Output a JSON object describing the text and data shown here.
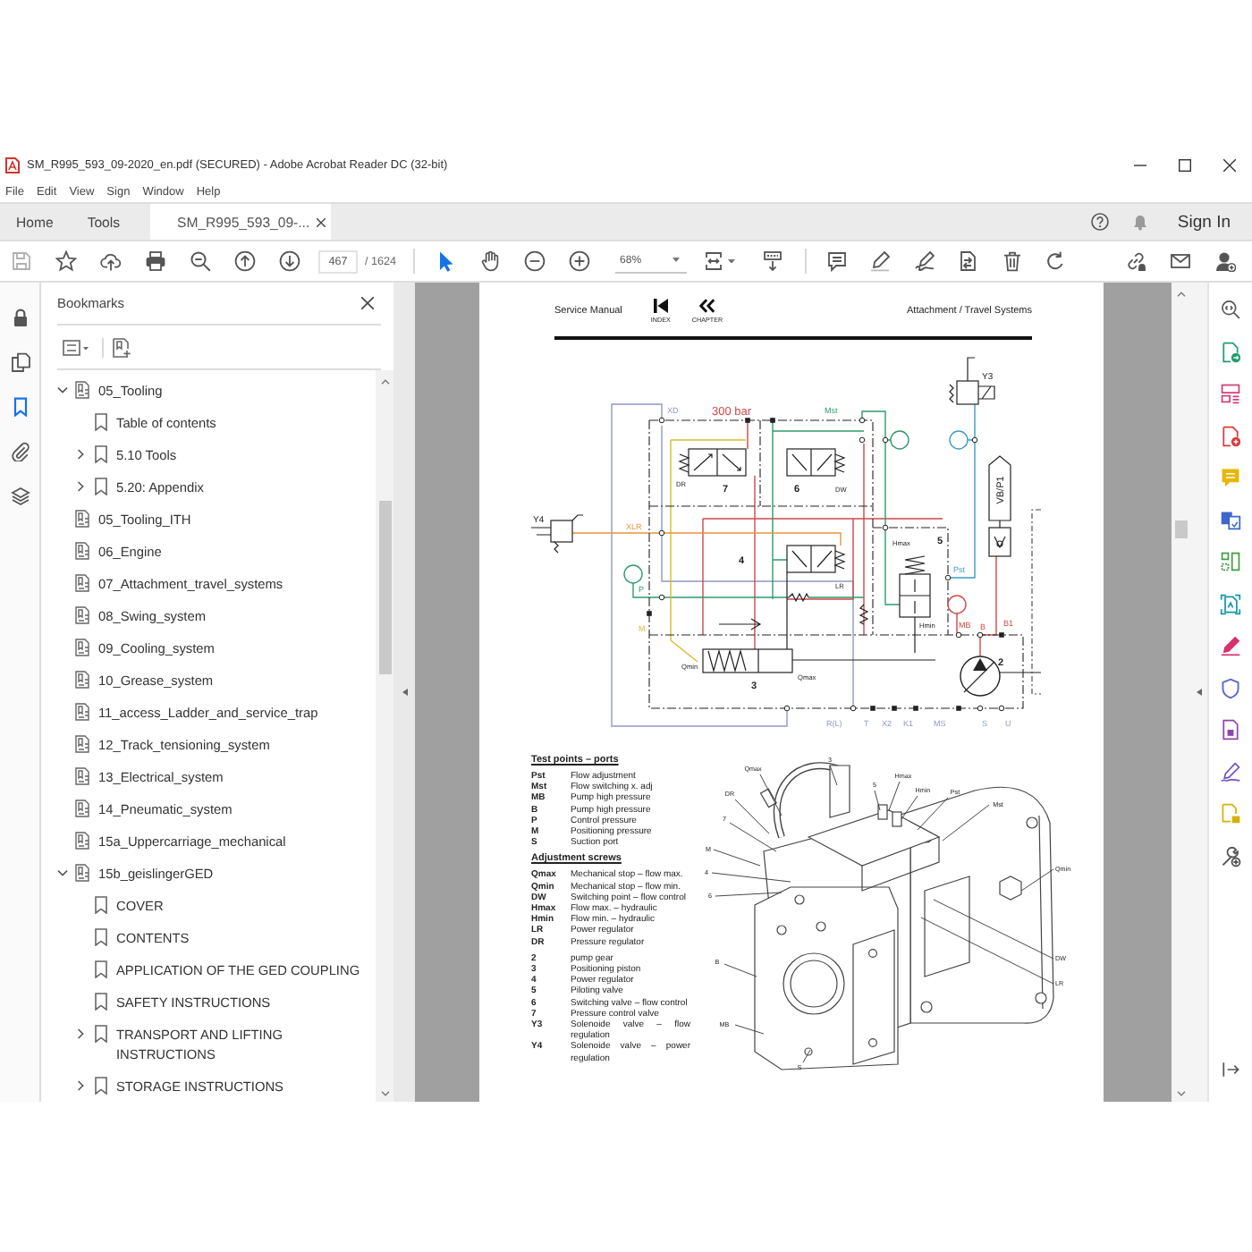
{
  "window": {
    "title": "SM_R995_593_09-2020_en.pdf (SECURED) - Adobe Acrobat Reader DC (32-bit)"
  },
  "menu": [
    "File",
    "Edit",
    "View",
    "Sign",
    "Window",
    "Help"
  ],
  "tabs": [
    {
      "label": "Home",
      "selected": false,
      "closable": false
    },
    {
      "label": "Tools",
      "selected": false,
      "closable": false
    },
    {
      "label": "SM_R995_593_09-...",
      "selected": true,
      "closable": true
    }
  ],
  "account": {
    "sign_in": "Sign In"
  },
  "toolbar": {
    "page_current": "467",
    "page_total": "/ 1624",
    "zoom": "68%",
    "tools": [
      {
        "selected": true
      },
      {
        "selected": false
      }
    ]
  },
  "left_rail": [
    {
      "selected": false
    },
    {
      "selected": false
    },
    {
      "selected": true
    },
    {
      "selected": false
    },
    {
      "selected": false
    }
  ],
  "bookmarks": {
    "title": "Bookmarks",
    "items": [
      {
        "label": "05_Tooling",
        "kind": "file",
        "expanded": true,
        "children": [
          {
            "label": "Table of contents",
            "kind": "bookmark"
          },
          {
            "label": "5.10 Tools",
            "kind": "bookmark",
            "expanded": false
          },
          {
            "label": "5.20: Appendix",
            "kind": "bookmark",
            "expanded": false
          }
        ]
      },
      {
        "label": "05_Tooling_ITH",
        "kind": "file"
      },
      {
        "label": "06_Engine",
        "kind": "file"
      },
      {
        "label": "07_Attachment_travel_systems",
        "kind": "file"
      },
      {
        "label": "08_Swing_system",
        "kind": "file"
      },
      {
        "label": "09_Cooling_system",
        "kind": "file"
      },
      {
        "label": "10_Grease_system",
        "kind": "file"
      },
      {
        "label": "11_access_Ladder_and_service_trap",
        "kind": "file"
      },
      {
        "label": "12_Track_tensioning_system",
        "kind": "file"
      },
      {
        "label": "13_Electrical_system",
        "kind": "file"
      },
      {
        "label": "14_Pneumatic_system",
        "kind": "file"
      },
      {
        "label": "15a_Uppercarriage_mechanical",
        "kind": "file"
      },
      {
        "label": "15b_geislingerGED",
        "kind": "file",
        "expanded": true,
        "children": [
          {
            "label": "COVER",
            "kind": "bookmark"
          },
          {
            "label": "CONTENTS",
            "kind": "bookmark"
          },
          {
            "label": "APPLICATION OF THE GED COUPLING",
            "kind": "bookmark"
          },
          {
            "label": "SAFETY INSTRUCTIONS",
            "kind": "bookmark"
          },
          {
            "label": "TRANSPORT AND LIFTING INSTRUCTIONS",
            "kind": "bookmark",
            "expanded": false
          },
          {
            "label": "STORAGE INSTRUCTIONS",
            "kind": "bookmark",
            "expanded": false
          }
        ]
      }
    ]
  },
  "document": {
    "header": {
      "left": "Service Manual",
      "nav": [
        "INDEX",
        "CHAPTER"
      ],
      "right": "Attachment / Travel Systems"
    },
    "schematic": {
      "labels": [
        "XD",
        "300 bar",
        "Mst",
        "Y3",
        "VB/P1",
        "7",
        "DR",
        "6",
        "DW",
        "Y4",
        "XLR",
        "4",
        "LR",
        "5",
        "Hmax",
        "Hmin",
        "Pst",
        "P",
        "M",
        "MB",
        "B",
        "B1",
        "2",
        "Qmin",
        "3",
        "Qmax",
        "R(L)",
        "T",
        "X2",
        "K1",
        "MS",
        "S",
        "U"
      ]
    },
    "legend": [
      {
        "title": "Test points – ports",
        "rows": [
          {
            "code": "Pst",
            "text": "Flow adjustment"
          },
          {
            "code": "Mst",
            "text": "Flow switching x. adj"
          },
          {
            "code": "MB",
            "text": "Pump high pressure"
          },
          {
            "code": "B",
            "text": "Pump high pressure"
          },
          {
            "code": "P",
            "text": "Control pressure"
          },
          {
            "code": "M",
            "text": "Positioning pressure"
          },
          {
            "code": "S",
            "text": "Suction port"
          }
        ]
      },
      {
        "title": "Adjustment screws",
        "rows": [
          {
            "code": "Qmax",
            "text": "Mechanical stop – flow max."
          },
          {
            "code": "Qmin",
            "text": "Mechanical stop – flow min."
          },
          {
            "code": "DW",
            "text": "Switching point – flow control"
          },
          {
            "code": "Hmax",
            "text": "Flow max. – hydraulic"
          },
          {
            "code": "Hmin",
            "text": "Flow min. – hydraulic"
          },
          {
            "code": "LR",
            "text": "Power regulator"
          },
          {
            "code": "DR",
            "text": "Pressure regulator"
          }
        ]
      },
      {
        "rows": [
          {
            "code": "2",
            "text": "pump gear"
          },
          {
            "code": "3",
            "text": "Positioning piston"
          },
          {
            "code": "4",
            "text": "Power regulator"
          },
          {
            "code": "5",
            "text": "Piloting valve"
          },
          {
            "code": "6",
            "text": "Switching valve – flow control"
          },
          {
            "code": "7",
            "text": "Pressure control valve"
          },
          {
            "code": "Y3",
            "text": "Solenoide valve – flow regulation"
          },
          {
            "code": "Y4",
            "text": "Solenoide valve – power regulation"
          }
        ]
      }
    ],
    "pump_drawing": {
      "callouts": [
        "Qmax",
        "3",
        "5",
        "Hmax",
        "Hmin",
        "Pst",
        "Mst",
        "DR",
        "7",
        "M",
        "4",
        "6",
        "Qmin",
        "DW",
        "LR",
        "B",
        "MB",
        "S"
      ]
    }
  }
}
